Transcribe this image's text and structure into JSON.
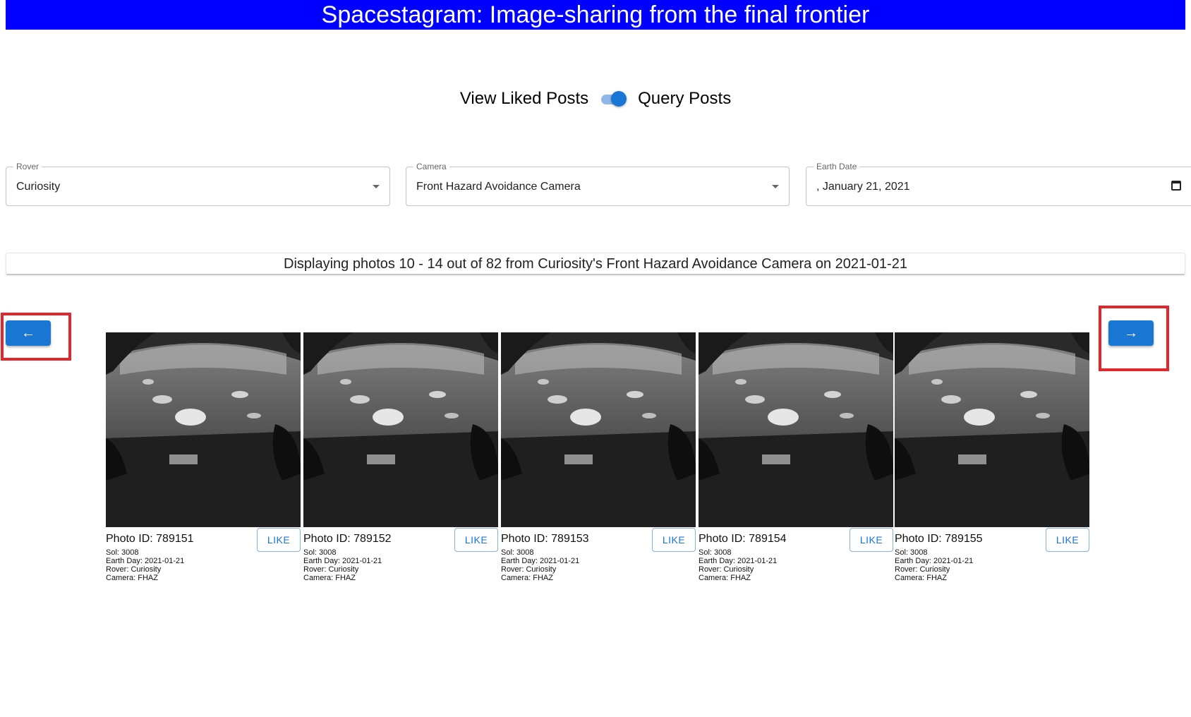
{
  "header": {
    "title": "Spacestagram: Image-sharing from the final frontier"
  },
  "toggle": {
    "left_label": "View Liked Posts",
    "right_label": "Query Posts",
    "state": "on"
  },
  "filters": {
    "rover": {
      "label": "Rover",
      "value": "Curiosity"
    },
    "camera": {
      "label": "Camera",
      "value": "Front Hazard Avoidance Camera"
    },
    "earth_date": {
      "label": "Earth Date",
      "value": ", January 21, 2021"
    }
  },
  "status": {
    "text": "Displaying photos 10 - 14 out of 82 from Curiosity's Front Hazard Avoidance Camera on 2021-01-21"
  },
  "nav": {
    "prev_label": "←",
    "next_label": "→"
  },
  "photos": [
    {
      "id_text": "Photo ID: 789151",
      "sol": "Sol: 3008",
      "earth_day": "Earth Day: 2021-01-21",
      "rover": "Rover: Curiosity",
      "camera": "Camera: FHAZ",
      "like_label": "LIKE"
    },
    {
      "id_text": "Photo ID: 789152",
      "sol": "Sol: 3008",
      "earth_day": "Earth Day: 2021-01-21",
      "rover": "Rover: Curiosity",
      "camera": "Camera: FHAZ",
      "like_label": "LIKE"
    },
    {
      "id_text": "Photo ID: 789153",
      "sol": "Sol: 3008",
      "earth_day": "Earth Day: 2021-01-21",
      "rover": "Rover: Curiosity",
      "camera": "Camera: FHAZ",
      "like_label": "LIKE"
    },
    {
      "id_text": "Photo ID: 789154",
      "sol": "Sol: 3008",
      "earth_day": "Earth Day: 2021-01-21",
      "rover": "Rover: Curiosity",
      "camera": "Camera: FHAZ",
      "like_label": "LIKE"
    },
    {
      "id_text": "Photo ID: 789155",
      "sol": "Sol: 3008",
      "earth_day": "Earth Day: 2021-01-21",
      "rover": "Rover: Curiosity",
      "camera": "Camera: FHAZ",
      "like_label": "LIKE"
    }
  ],
  "colors": {
    "header_bg": "#0000ff",
    "accent": "#1976d2",
    "highlight": "#e3262b"
  },
  "icons": {
    "rover_dropdown": "chevron-down-icon",
    "camera_dropdown": "chevron-down-icon",
    "date": "calendar-icon"
  }
}
